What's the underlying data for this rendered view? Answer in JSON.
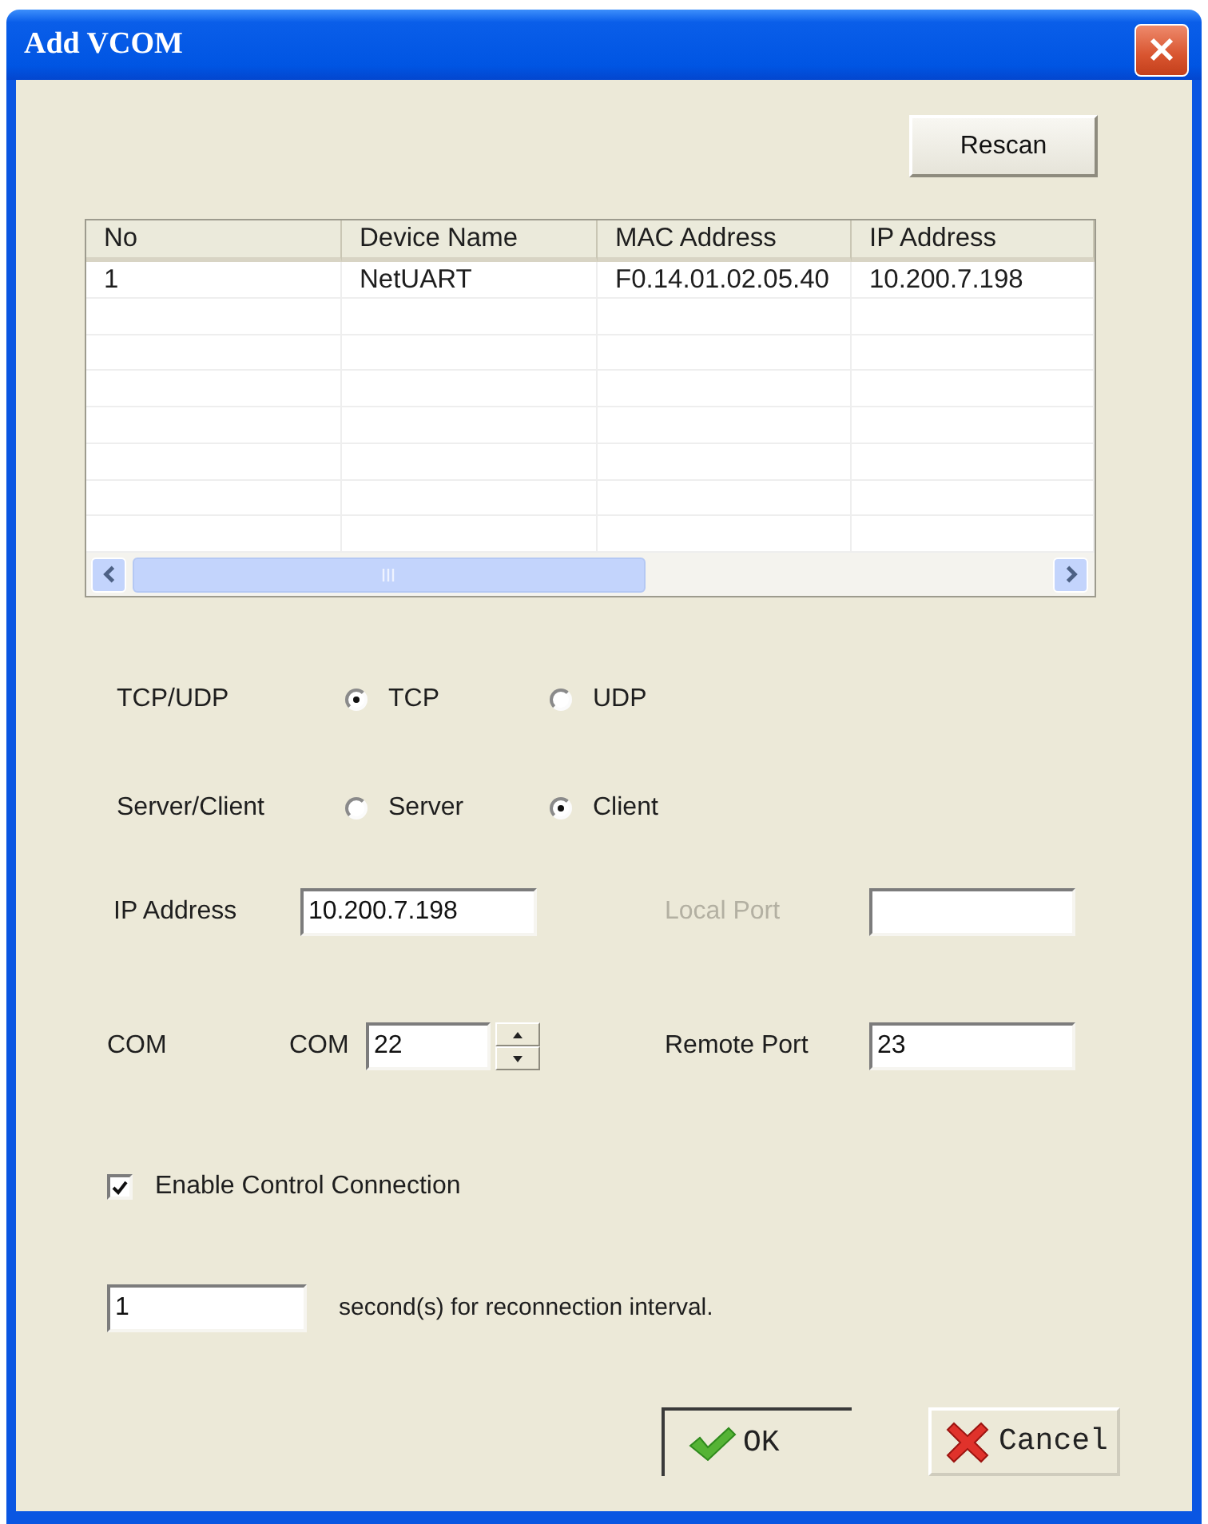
{
  "window": {
    "title": "Add VCOM"
  },
  "rescan_button": {
    "label": "Rescan"
  },
  "device_table": {
    "columns": [
      "No",
      "Device Name",
      "MAC Address",
      "IP Address"
    ],
    "rows": [
      [
        "1",
        "NetUART",
        "F0.14.01.02.05.40",
        "10.200.7.198"
      ]
    ]
  },
  "protocol": {
    "label": "TCP/UDP",
    "options": [
      {
        "label": "TCP",
        "selected": true
      },
      {
        "label": "UDP",
        "selected": false
      }
    ]
  },
  "role": {
    "label": "Server/Client",
    "options": [
      {
        "label": "Server",
        "selected": false
      },
      {
        "label": "Client",
        "selected": true
      }
    ]
  },
  "ip_address": {
    "label": "IP Address",
    "value": "10.200.7.198"
  },
  "local_port": {
    "label": "Local Port",
    "disabled": true
  },
  "com": {
    "label": "COM",
    "prefix": "COM",
    "value": "22"
  },
  "remote_port": {
    "label": "Remote Port",
    "value": "23"
  },
  "control_connection": {
    "label": "Enable Control Connection",
    "checked": true
  },
  "reconnection_interval": {
    "value": "1",
    "suffix": "second(s) for reconnection interval."
  },
  "buttons": [
    {
      "label": "OK",
      "kind": "ok"
    },
    {
      "label": "Cancel",
      "kind": "cancel"
    }
  ]
}
